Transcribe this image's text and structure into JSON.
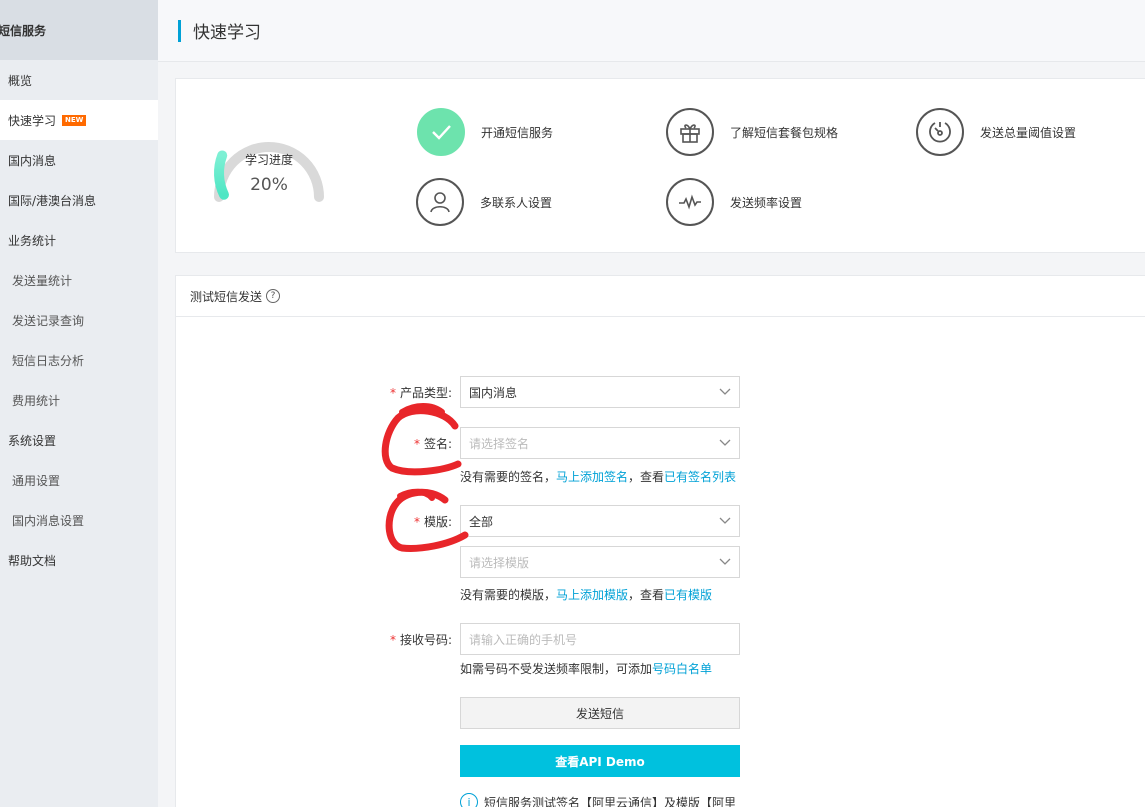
{
  "sidebar": {
    "header": "短信服务",
    "items": [
      {
        "label": "概览"
      },
      {
        "label": "快速学习",
        "badge": "NEW"
      },
      {
        "label": "国内消息"
      },
      {
        "label": "国际/港澳台消息"
      },
      {
        "label": "业务统计"
      },
      {
        "label": "发送量统计"
      },
      {
        "label": "发送记录查询"
      },
      {
        "label": "短信日志分析"
      },
      {
        "label": "费用统计"
      },
      {
        "label": "系统设置"
      },
      {
        "label": "通用设置"
      },
      {
        "label": "国内消息设置"
      },
      {
        "label": "帮助文档"
      }
    ]
  },
  "header": {
    "title": "快速学习"
  },
  "guide": {
    "progress_label": "学习进度",
    "progress_value": "20%",
    "progress_fraction": 0.2,
    "steps": [
      {
        "label": "开通短信服务",
        "icon": "check-icon",
        "done": true
      },
      {
        "label": "了解短信套餐包规格",
        "icon": "gift-icon",
        "done": false
      },
      {
        "label": "发送总量阈值设置",
        "icon": "gauge-icon",
        "done": false
      },
      {
        "label": "多联系人设置",
        "icon": "user-icon",
        "done": false
      },
      {
        "label": "发送频率设置",
        "icon": "pulse-icon",
        "done": false
      }
    ]
  },
  "test_panel": {
    "title": "测试短信发送",
    "product_type": {
      "label": "产品类型:",
      "value": "国内消息"
    },
    "signature": {
      "label": "签名:",
      "placeholder": "请选择签名",
      "hint_prefix": "没有需要的签名，",
      "hint_link1": "马上添加签名",
      "hint_mid": "，查看",
      "hint_link2": "已有签名列表"
    },
    "template": {
      "label": "模版:",
      "value": "全部",
      "placeholder": "请选择模版",
      "hint_prefix": "没有需要的模版，",
      "hint_link1": "马上添加模版",
      "hint_mid": "，查看",
      "hint_link2": "已有模版"
    },
    "phone": {
      "label": "接收号码:",
      "placeholder": "请输入正确的手机号",
      "hint_prefix": "如需号码不受发送频率限制，可添加",
      "hint_link": "号码白名单"
    },
    "send_button": "发送短信",
    "demo_button": "查看API Demo",
    "notice": "短信服务测试签名【阿里云通信】及模版【阿里"
  },
  "colors": {
    "accent": "#00a1d6",
    "demo_button": "#00c1de",
    "done_step": "#6de3ad",
    "required": "#e33333",
    "annotation": "#e8262a"
  }
}
